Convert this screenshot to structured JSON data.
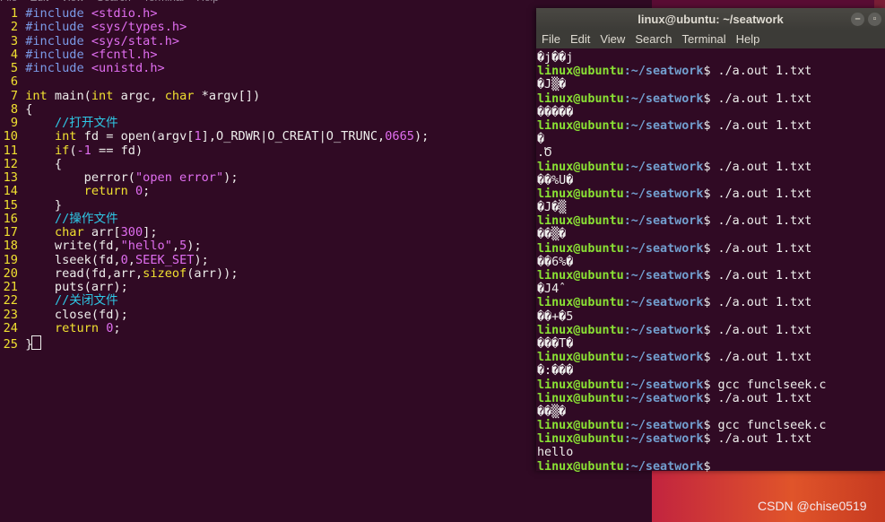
{
  "vim": {
    "menu": [
      "File",
      "Edit",
      "View",
      "Search",
      "Terminal",
      "Help"
    ],
    "lines": [
      {
        "n": "1",
        "segs": [
          [
            "inc",
            "#include "
          ],
          [
            "hdr",
            "<stdio.h>"
          ]
        ]
      },
      {
        "n": "2",
        "segs": [
          [
            "inc",
            "#include "
          ],
          [
            "hdr",
            "<sys/types.h>"
          ]
        ]
      },
      {
        "n": "3",
        "segs": [
          [
            "inc",
            "#include "
          ],
          [
            "hdr",
            "<sys/stat.h>"
          ]
        ]
      },
      {
        "n": "4",
        "segs": [
          [
            "inc",
            "#include "
          ],
          [
            "hdr",
            "<fcntl.h>"
          ]
        ]
      },
      {
        "n": "5",
        "segs": [
          [
            "inc",
            "#include "
          ],
          [
            "hdr",
            "<unistd.h>"
          ]
        ]
      },
      {
        "n": "6",
        "segs": []
      },
      {
        "n": "7",
        "segs": [
          [
            "kw",
            "int"
          ],
          [
            "src",
            " main("
          ],
          [
            "kw",
            "int"
          ],
          [
            "src",
            " argc, "
          ],
          [
            "kw",
            "char"
          ],
          [
            "src",
            " *argv[])"
          ]
        ]
      },
      {
        "n": "8",
        "segs": [
          [
            "src",
            "{"
          ]
        ]
      },
      {
        "n": "9",
        "segs": [
          [
            "src",
            "    "
          ],
          [
            "cmt",
            "//打开文件"
          ]
        ]
      },
      {
        "n": "10",
        "segs": [
          [
            "src",
            "    "
          ],
          [
            "kw",
            "int"
          ],
          [
            "src",
            " fd = open(argv["
          ],
          [
            "num",
            "1"
          ],
          [
            "src",
            "],O_RDWR|O_CREAT|O_TRUNC,"
          ],
          [
            "num",
            "0665"
          ],
          [
            "src",
            ");"
          ]
        ]
      },
      {
        "n": "11",
        "segs": [
          [
            "src",
            "    "
          ],
          [
            "kw",
            "if"
          ],
          [
            "src",
            "("
          ],
          [
            "num",
            "-1"
          ],
          [
            "src",
            " == fd)"
          ]
        ]
      },
      {
        "n": "12",
        "segs": [
          [
            "src",
            "    {"
          ]
        ]
      },
      {
        "n": "13",
        "segs": [
          [
            "src",
            "        perror("
          ],
          [
            "str",
            "\"open error\""
          ],
          [
            "src",
            ");"
          ]
        ]
      },
      {
        "n": "14",
        "segs": [
          [
            "src",
            "        "
          ],
          [
            "kw",
            "return"
          ],
          [
            "src",
            " "
          ],
          [
            "num",
            "0"
          ],
          [
            "src",
            ";"
          ]
        ]
      },
      {
        "n": "15",
        "segs": [
          [
            "src",
            "    }"
          ]
        ]
      },
      {
        "n": "16",
        "segs": [
          [
            "src",
            "    "
          ],
          [
            "cmt",
            "//操作文件"
          ]
        ]
      },
      {
        "n": "17",
        "segs": [
          [
            "src",
            "    "
          ],
          [
            "kw",
            "char"
          ],
          [
            "src",
            " arr["
          ],
          [
            "num",
            "300"
          ],
          [
            "src",
            "];"
          ]
        ]
      },
      {
        "n": "18",
        "segs": [
          [
            "src",
            "    write(fd,"
          ],
          [
            "str",
            "\"hello\""
          ],
          [
            "src",
            ","
          ],
          [
            "num",
            "5"
          ],
          [
            "src",
            ");"
          ]
        ]
      },
      {
        "n": "19",
        "segs": [
          [
            "src",
            "    lseek(fd,"
          ],
          [
            "num",
            "0"
          ],
          [
            "src",
            ","
          ],
          [
            "mac",
            "SEEK_SET"
          ],
          [
            "src",
            ");"
          ]
        ]
      },
      {
        "n": "20",
        "segs": [
          [
            "src",
            "    read(fd,arr,"
          ],
          [
            "kw",
            "sizeof"
          ],
          [
            "src",
            "(arr));"
          ]
        ]
      },
      {
        "n": "21",
        "segs": [
          [
            "src",
            "    puts(arr);"
          ]
        ]
      },
      {
        "n": "22",
        "segs": [
          [
            "src",
            "    "
          ],
          [
            "cmt",
            "//关闭文件"
          ]
        ]
      },
      {
        "n": "23",
        "segs": [
          [
            "src",
            "    close(fd);"
          ]
        ]
      },
      {
        "n": "24",
        "segs": [
          [
            "src",
            "    "
          ],
          [
            "kw",
            "return"
          ],
          [
            "src",
            " "
          ],
          [
            "num",
            "0"
          ],
          [
            "src",
            ";"
          ]
        ]
      },
      {
        "n": "25",
        "segs": [
          [
            "src",
            "}"
          ]
        ],
        "cursor": true
      }
    ]
  },
  "terminal": {
    "title": "linux@ubuntu: ~/seatwork",
    "menu": [
      "File",
      "Edit",
      "View",
      "Search",
      "Terminal",
      "Help"
    ],
    "prompt_user": "linux@ubuntu",
    "prompt_path": ":~/seatwork",
    "lines": [
      {
        "t": "out",
        "text": "�j��j"
      },
      {
        "t": "cmd",
        "cmd": "$ ./a.out 1.txt"
      },
      {
        "t": "out",
        "text": "�J▒�"
      },
      {
        "t": "cmd",
        "cmd": "$ ./a.out 1.txt"
      },
      {
        "t": "out",
        "text": "�����"
      },
      {
        "t": "cmd",
        "cmd": "$ ./a.out 1.txt"
      },
      {
        "t": "out",
        "text": "�"
      },
      {
        "t": "out",
        "text": ".Ծ"
      },
      {
        "t": "cmd",
        "cmd": "$ ./a.out 1.txt"
      },
      {
        "t": "out",
        "text": "��%U�"
      },
      {
        "t": "cmd",
        "cmd": "$ ./a.out 1.txt"
      },
      {
        "t": "out",
        "text": "�J�▒"
      },
      {
        "t": "cmd",
        "cmd": "$ ./a.out 1.txt"
      },
      {
        "t": "out",
        "text": "��▒�"
      },
      {
        "t": "cmd",
        "cmd": "$ ./a.out 1.txt"
      },
      {
        "t": "out",
        "text": "��6%�"
      },
      {
        "t": "cmd",
        "cmd": "$ ./a.out 1.txt"
      },
      {
        "t": "out",
        "text": "�J4̂"
      },
      {
        "t": "cmd",
        "cmd": "$ ./a.out 1.txt"
      },
      {
        "t": "out",
        "text": "��+�5"
      },
      {
        "t": "cmd",
        "cmd": "$ ./a.out 1.txt"
      },
      {
        "t": "out",
        "text": "���T�"
      },
      {
        "t": "cmd",
        "cmd": "$ ./a.out 1.txt"
      },
      {
        "t": "out",
        "text": "�:���"
      },
      {
        "t": "cmd",
        "cmd": "$ gcc funclseek.c"
      },
      {
        "t": "cmd",
        "cmd": "$ ./a.out 1.txt"
      },
      {
        "t": "out",
        "text": "��▒�"
      },
      {
        "t": "cmd",
        "cmd": "$ gcc funclseek.c"
      },
      {
        "t": "cmd",
        "cmd": "$ ./a.out 1.txt"
      },
      {
        "t": "out",
        "text": "hello"
      },
      {
        "t": "cmd",
        "cmd": "$ "
      }
    ]
  },
  "watermark": "CSDN @chise0519",
  "colors": {
    "terminal_bg": "#300a24",
    "prompt_user": "#8ae234",
    "prompt_path": "#729fcf"
  }
}
